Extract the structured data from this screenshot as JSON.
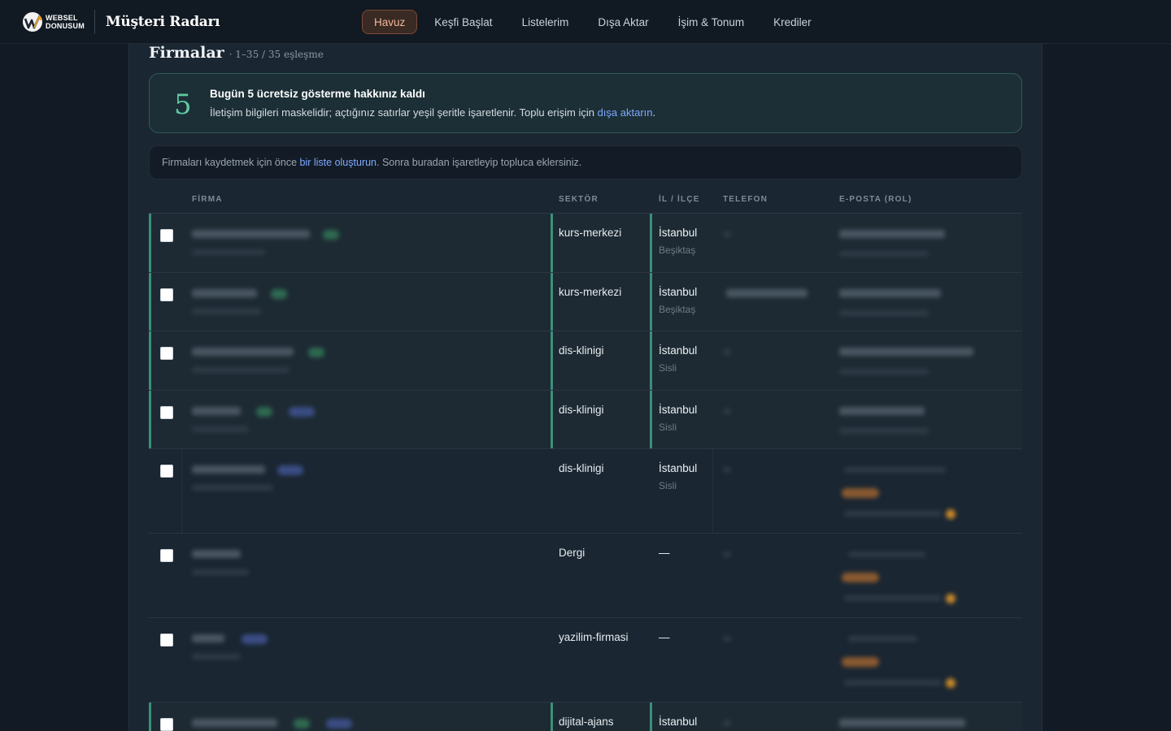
{
  "brand": {
    "logo_line1": "WEBSEL",
    "logo_line2": "DONUSUM",
    "app_title": "Müşteri Radarı"
  },
  "nav": [
    {
      "label": "Havuz",
      "active": true
    },
    {
      "label": "Keşfi Başlat"
    },
    {
      "label": "Listelerim"
    },
    {
      "label": "Dışa Aktar"
    },
    {
      "label": "İşim & Tonum"
    },
    {
      "label": "Krediler"
    }
  ],
  "page": {
    "title": "Firmalar",
    "count": "· 1–35 / 35 eşleşme"
  },
  "quota": {
    "number": "5",
    "title": "Bugün 5 ücretsiz gösterme hakkınız kaldı",
    "desc_before": "İletişim bilgileri maskelidir; açtığınız satırlar yeşil şeritle işaretlenir. Toplu erişim için ",
    "desc_link": "dışa aktarın",
    "desc_after": "."
  },
  "hint": {
    "before": "Firmaları kaydetmek için önce ",
    "link": "bir liste oluşturun",
    "after": ". Sonra buradan işaretleyip topluca eklersiniz."
  },
  "table": {
    "headers": {
      "firm": "FİRMA",
      "sector": "SEKTÖR",
      "location": "İL / İLÇE",
      "phone": "TELEFON",
      "email": "E-POSTA (ROL)"
    },
    "rows": [
      {
        "sector": "kurs-merkezi",
        "city": "İstanbul",
        "district": "Beşiktaş",
        "opened": true
      },
      {
        "sector": "kurs-merkezi",
        "city": "İstanbul",
        "district": "Beşiktaş",
        "opened": true
      },
      {
        "sector": "dis-klinigi",
        "city": "İstanbul",
        "district": "Sisli",
        "opened": true
      },
      {
        "sector": "dis-klinigi",
        "city": "İstanbul",
        "district": "Sisli",
        "opened": true
      },
      {
        "sector": "dis-klinigi",
        "city": "İstanbul",
        "district": "Sisli",
        "opened": false
      },
      {
        "sector": "Dergi",
        "city": "—",
        "district": "",
        "opened": false
      },
      {
        "sector": "yazilim-firmasi",
        "city": "—",
        "district": "",
        "opened": false
      },
      {
        "sector": "dijital-ajans",
        "city": "İstanbul",
        "district": "",
        "opened": true
      }
    ]
  },
  "colors": {
    "accent_green": "#5fc9a0",
    "active_nav": "#f1b59a",
    "link": "#7ea8ff"
  }
}
